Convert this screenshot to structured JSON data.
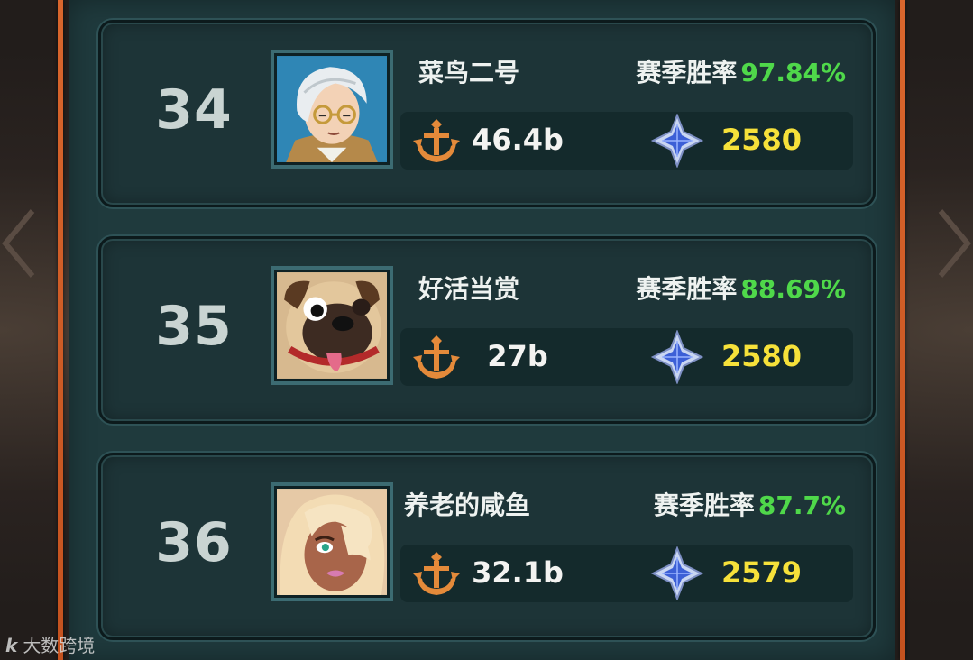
{
  "entries": [
    {
      "rank": "34",
      "name": "菜鸟二号",
      "winrate_label": "赛季胜率",
      "winrate": "97.84%",
      "power": "46.4b",
      "score": "2580",
      "avatar": "gentleman-avatar"
    },
    {
      "rank": "35",
      "name": "好活当赏",
      "winrate_label": "赛季胜率",
      "winrate": "88.69%",
      "power": "27b",
      "score": "2580",
      "avatar": "pug-avatar"
    },
    {
      "rank": "36",
      "name": "养老的咸鱼",
      "winrate_label": "赛季胜率",
      "winrate": "87.7%",
      "power": "32.1b",
      "score": "2579",
      "avatar": "blonde-woman-avatar"
    }
  ],
  "icons": {
    "power": "anchor-icon",
    "score": "crystal-rank-icon"
  },
  "watermark": {
    "logo": "k",
    "text": "大数跨境"
  },
  "colors": {
    "winrate": "#4fd84a",
    "score": "#f6e13a",
    "frame": "#d9662d",
    "panel": "#1f3a3d"
  }
}
